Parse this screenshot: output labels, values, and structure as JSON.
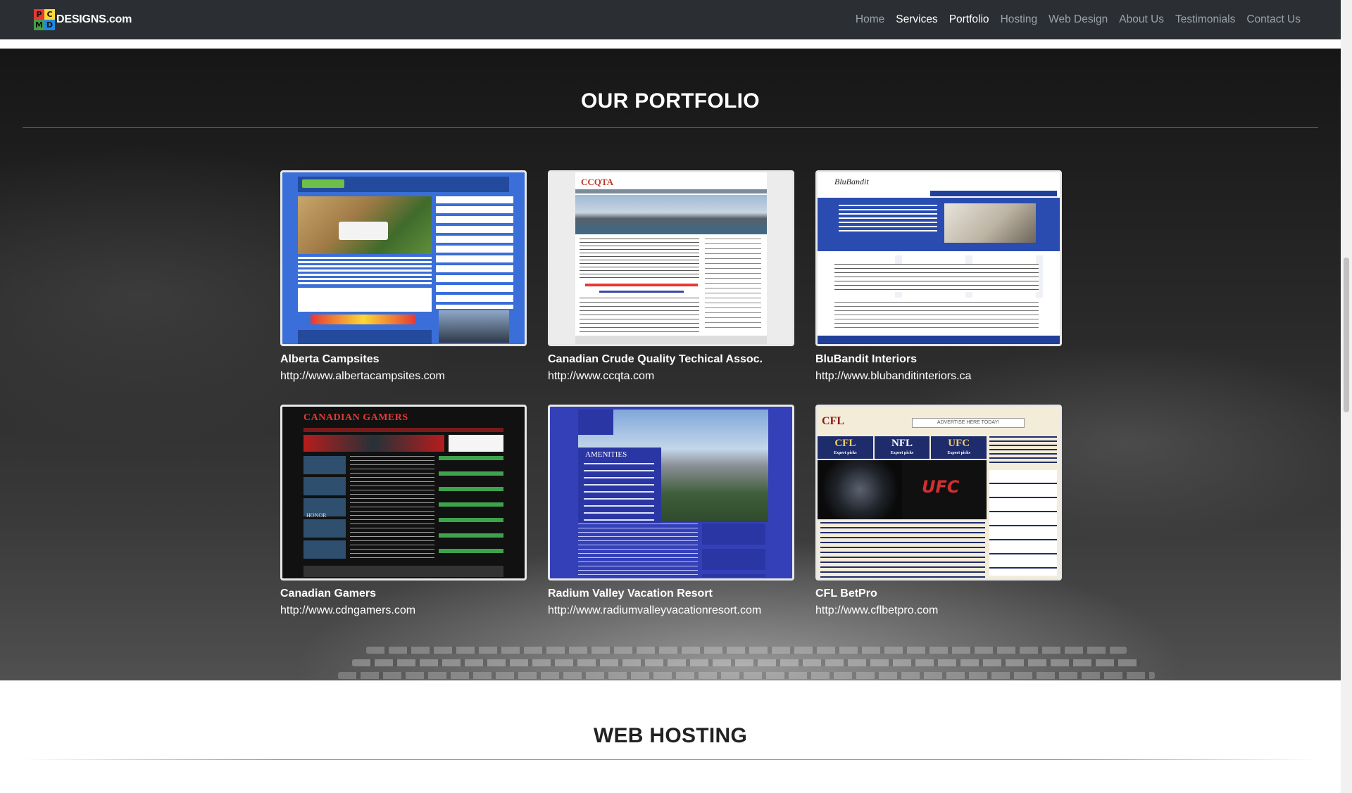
{
  "nav": {
    "logo_letters": [
      "P",
      "C",
      "M",
      "D"
    ],
    "logo_text": "DESIGNS.com",
    "links": [
      {
        "label": "Home"
      },
      {
        "label": "Services"
      },
      {
        "label": "Portfolio"
      },
      {
        "label": "Hosting"
      },
      {
        "label": "Web Design"
      },
      {
        "label": "About Us"
      },
      {
        "label": "Testimonials"
      },
      {
        "label": "Contact Us"
      }
    ]
  },
  "portfolio": {
    "title": "OUR PORTFOLIO",
    "items": [
      {
        "name": "Alberta Campsites",
        "url": "http://www.albertacampsites.com"
      },
      {
        "name": "Canadian Crude Quality Techical Assoc.",
        "url": "http://www.ccqta.com"
      },
      {
        "name": "BluBandit Interiors",
        "url": "http://www.blubanditinteriors.ca"
      },
      {
        "name": "Canadian Gamers",
        "url": "http://www.cdngamers.com"
      },
      {
        "name": "Radium Valley Vacation Resort",
        "url": "http://www.radiumvalleyvacationresort.com"
      },
      {
        "name": "CFL BetPro",
        "url": "http://www.cflbetpro.com"
      }
    ],
    "thumb_text": {
      "ccqta_logo": "CCQTA",
      "blubandit_logo": "BluBandit",
      "gamers_banner": "CANADIAN GAMERS",
      "gamers_honor": "HONOR",
      "radium_amenities": "AMENITIES",
      "cfl_logo": "CFL",
      "cfl_ad": "ADVERTISE HERE TODAY!",
      "cfl_tabs": [
        "CFL",
        "NFL",
        "UFC"
      ],
      "cfl_expert": "Expert picks",
      "cfl_ufc": "UFC"
    }
  },
  "hosting": {
    "title": "WEB HOSTING"
  },
  "colors": {
    "nav_bg": "#2b2f33",
    "nav_text": "#9ba3ab",
    "nav_active": "#ffffff",
    "logo_p": "#e53935",
    "logo_c": "#fdd835",
    "logo_m": "#43a047",
    "logo_d": "#1e88e5"
  }
}
